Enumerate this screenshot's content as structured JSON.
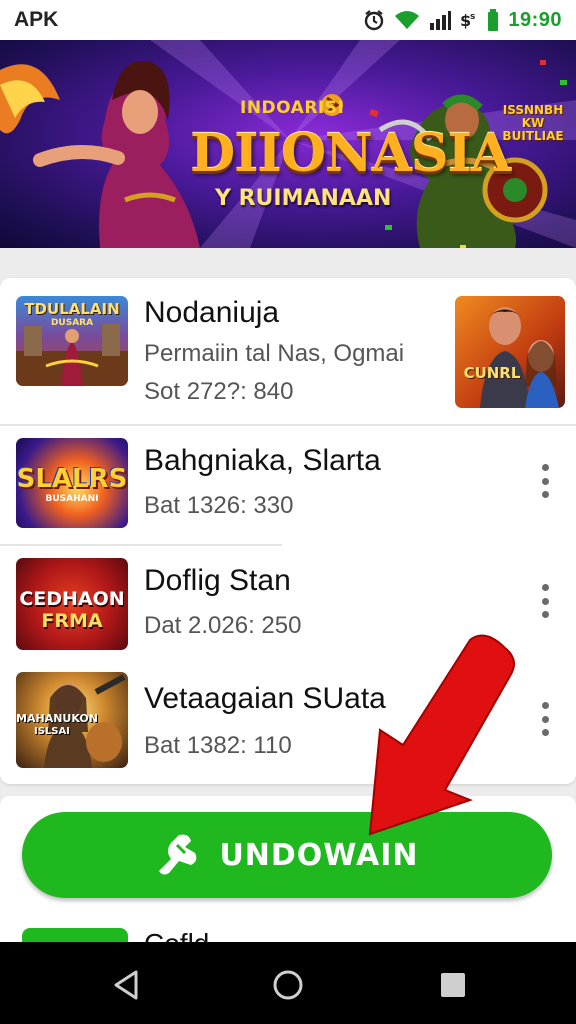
{
  "status_bar": {
    "left_label": "APK",
    "time": "19:90",
    "icons": [
      "alarm-icon",
      "wifi-icon",
      "signal-icon",
      "data-icon",
      "battery-icon"
    ],
    "accent_color": "#1a9e2c"
  },
  "banner": {
    "small_text": "INDOARISI",
    "title": "DIIONASIA",
    "subtitle": "Y RUIMANAAN",
    "right_text_line1": "ISSNNBH KW",
    "right_text_line2": "BUITLIAE"
  },
  "apps": [
    {
      "title": "Nodaniuja",
      "subtitle": "Permaiin  tal Nas, Ogmai",
      "meta": "Sot 272?: 840",
      "thumb_text": "TDULALAIN",
      "thumb_subtext": "DUSARA",
      "side_thumb_text": "CUNRL"
    },
    {
      "title": "Bahgniaka, Slarta",
      "meta": "Bat 1326: 330",
      "thumb_text": "SLALRS",
      "thumb_subtext": "BUSAHANI"
    },
    {
      "title": "Doflig Stan",
      "meta": "Dat 2.026: 250",
      "thumb_text": "CEDHAON",
      "thumb_subtext": "FRMA"
    },
    {
      "title": "Vetaagaian SUata",
      "meta": "Bat 1382: 110",
      "thumb_text": "MAHANUKON",
      "thumb_subtext": "ISLSAI"
    }
  ],
  "download_button": {
    "label": "UNDOWAIN",
    "icon": "download-hand-icon",
    "color": "#1fb81f"
  },
  "next_item": {
    "title": "Cofld..."
  },
  "nav_bar": {
    "buttons": [
      "back-icon",
      "home-icon",
      "recents-icon"
    ]
  }
}
